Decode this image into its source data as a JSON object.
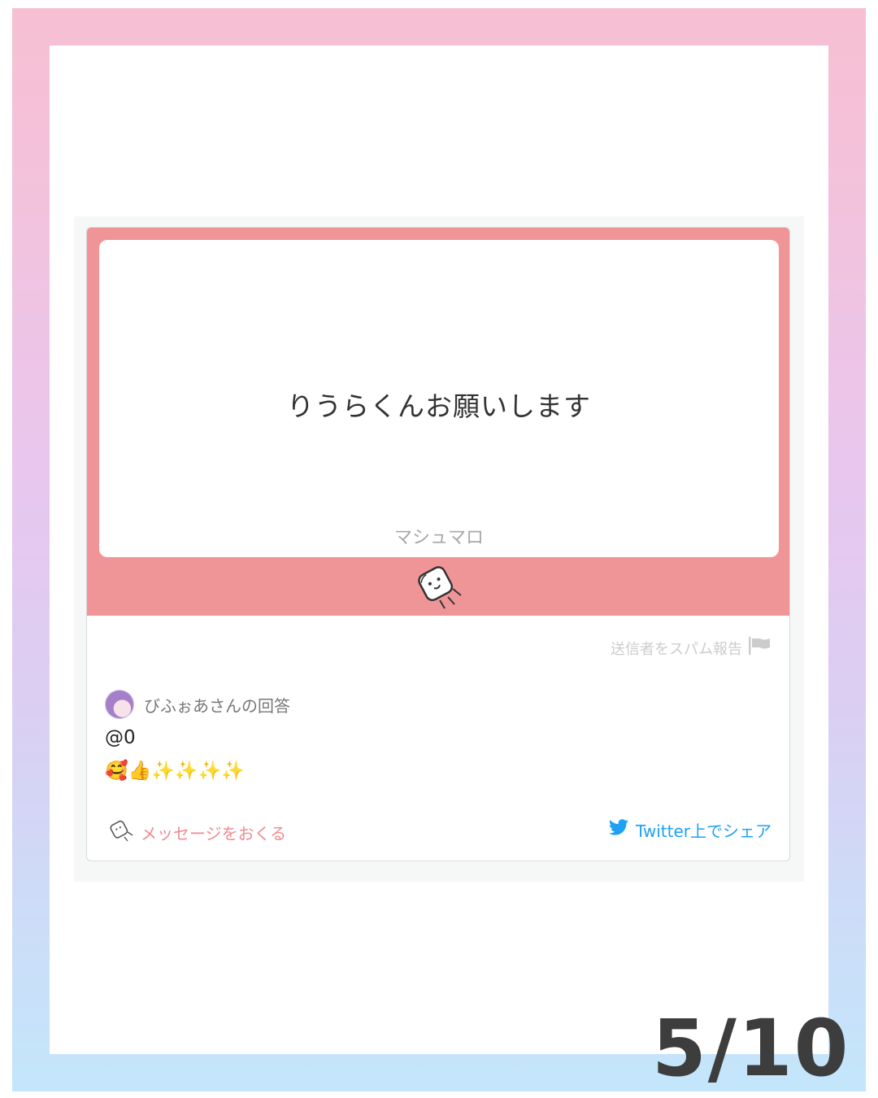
{
  "question": {
    "text": "りうらくんお願いします",
    "brand": "マシュマロ"
  },
  "report": {
    "label": "送信者をスパム報告"
  },
  "answer": {
    "answerer_label": "びふぉあさんの回答",
    "line1": "@0",
    "line2": "🥰👍✨✨✨✨"
  },
  "actions": {
    "send_message": "メッセージをおくる",
    "share_twitter": "Twitter上でシェア"
  },
  "page_counter": "5/10",
  "colors": {
    "accent_pink": "#f09597",
    "link_pink": "#ee8b90",
    "twitter_blue": "#1da1f2"
  }
}
